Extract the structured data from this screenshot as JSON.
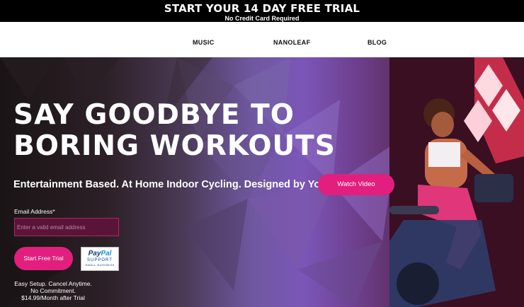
{
  "topbar": {
    "headline": "START YOUR 14 DAY FREE TRIAL",
    "subline": "No Credit Card Required"
  },
  "nav": {
    "items": [
      {
        "label": "MUSIC"
      },
      {
        "label": "NANOLEAF"
      },
      {
        "label": "BLOG"
      }
    ]
  },
  "hero": {
    "headline_line1": "SAY GOODBYE TO",
    "headline_line2": "BORING WORKOUTS",
    "subheadline": "Entertainment Based. At Home Indoor Cycling. Designed by You.",
    "watch_button": "Watch Video",
    "email_label": "Email Address*",
    "email_placeholder": "Enter a valid email address",
    "start_button": "Start Free Trial",
    "paypal_badge": {
      "brand_pay": "Pay",
      "brand_pal": "Pal",
      "line1": "SUPPORT",
      "line2": "SMALL BUSINESS"
    },
    "fine_print": [
      "Easy Setup. Cancel Anytime.",
      "No Commitment.",
      "$14.99/Month after Trial"
    ]
  },
  "colors": {
    "accent_pink": "#e21f7e",
    "topbar_bg": "#000000",
    "nav_bg": "#ffffff"
  }
}
